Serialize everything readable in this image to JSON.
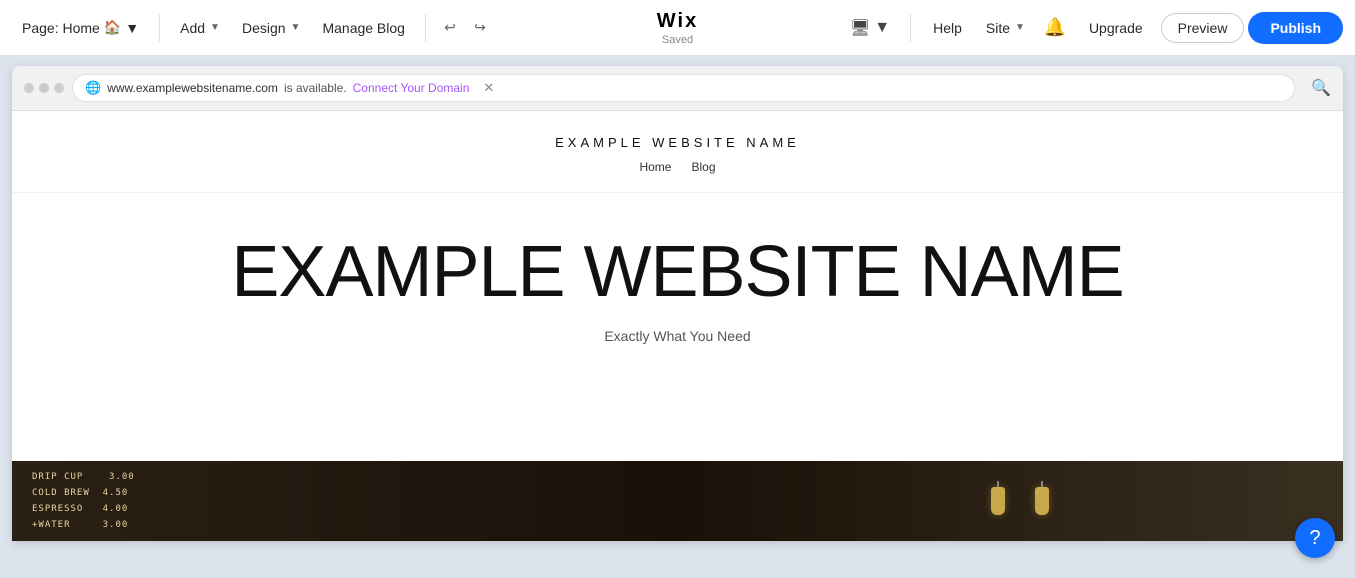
{
  "toolbar": {
    "page_label": "Page: Home",
    "home_icon": "🏠",
    "add_label": "Add",
    "design_label": "Design",
    "manage_blog_label": "Manage Blog",
    "wix_logo": "Wix",
    "saved_status": "Saved",
    "help_label": "Help",
    "site_label": "Site",
    "upgrade_label": "Upgrade",
    "preview_label": "Preview",
    "publish_label": "Publish"
  },
  "browser": {
    "url": "www.examplewebsitename.com",
    "available_text": "is available.",
    "connect_domain_label": "Connect Your Domain"
  },
  "website": {
    "site_name_header": "EXAMPLE WEBSITE NAME",
    "nav_home": "Home",
    "nav_blog": "Blog",
    "hero_title": "EXAMPLE WEBSITE NAME",
    "hero_subtitle": "Exactly What You Need"
  },
  "coffee": {
    "menu_lines": [
      "DRIP CUP",
      "COLD BREW",
      "ESPRESSO",
      "+WATER"
    ],
    "prices": [
      "3.00",
      "4.50",
      "4.00",
      "3.00"
    ]
  }
}
